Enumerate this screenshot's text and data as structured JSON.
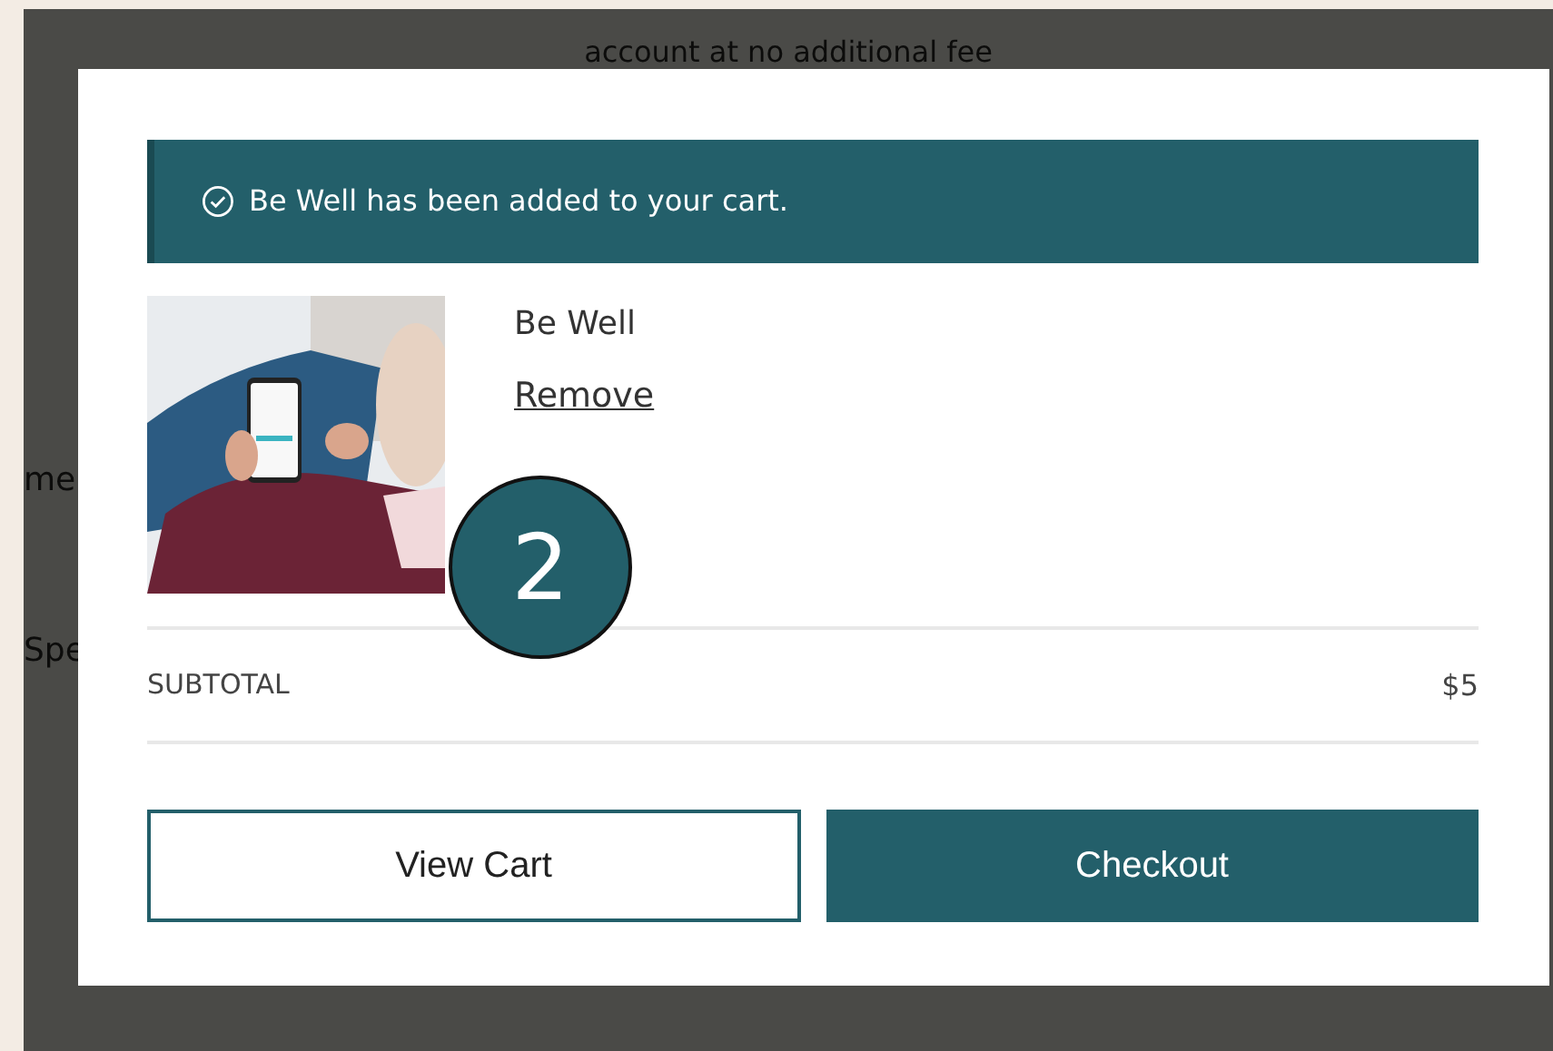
{
  "background_page": {
    "texts": [
      "account at no additional fee",
      "me",
      "Spe"
    ]
  },
  "modal": {
    "alert": {
      "product": "Be Well",
      "message": " has been added to your cart."
    },
    "item": {
      "name": "Be Well",
      "remove_link": "Remove"
    },
    "subtotal": {
      "label": "SUBTOTAL",
      "value": "$5"
    },
    "buttons": [
      {
        "label": "View Cart",
        "kind": "outline"
      },
      {
        "label": "Checkout",
        "kind": "primary"
      }
    ]
  },
  "callout": {
    "number": "2"
  }
}
